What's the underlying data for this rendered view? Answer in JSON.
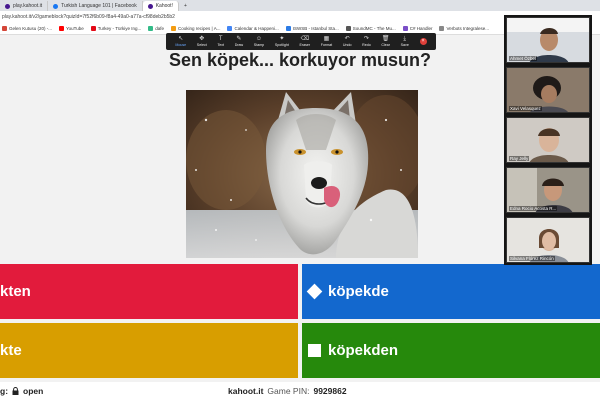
{
  "browser": {
    "tabs": [
      {
        "label": "play.kahoot.it",
        "color": "#46178f"
      },
      {
        "label": "Turkish Language 101 | Facebook",
        "color": "#1877f2"
      },
      {
        "label": "Kahoot!",
        "color": "#46178f"
      }
    ],
    "new_tab": "+",
    "url": "play.kahoot.it/v2/gameblock?quizId=7f52f6b09-f8a4-49a0-a77a-cf98deb2b5b2"
  },
  "bookmarks": [
    {
      "label": "Gelen Kutusu (20) -...",
      "color": "#d44638"
    },
    {
      "label": "YouTube",
      "color": "#ff0000"
    },
    {
      "label": "Turkey - Türkiye Ing...",
      "color": "#e30a17"
    },
    {
      "label": "dafe",
      "color": "#3b8"
    },
    {
      "label": "Cooking recipes | A...",
      "color": "#f39c12"
    },
    {
      "label": "Calendar & Happeni...",
      "color": "#4285f4"
    },
    {
      "label": "ISWSB - Istanbul Sta...",
      "color": "#2c7be5"
    },
    {
      "label": "SoundMC - The Mu...",
      "color": "#555555"
    },
    {
      "label": "C# Handler",
      "color": "#7b4fc7"
    },
    {
      "label": "Verbots Integralese...",
      "color": "#888888"
    }
  ],
  "zoom_toolbar": {
    "tools": [
      {
        "label": "Mouse",
        "icon": "↖"
      },
      {
        "label": "Select",
        "icon": "✥"
      },
      {
        "label": "Text",
        "icon": "T"
      },
      {
        "label": "Draw",
        "icon": "✎"
      },
      {
        "label": "Stamp",
        "icon": "☺"
      },
      {
        "label": "Spotlight",
        "icon": "✦"
      },
      {
        "label": "Eraser",
        "icon": "⌫"
      },
      {
        "label": "Format",
        "icon": "▦"
      },
      {
        "label": "Undo",
        "icon": "↶"
      },
      {
        "label": "Redo",
        "icon": "↷"
      },
      {
        "label": "Clear",
        "icon": "🗑"
      },
      {
        "label": "Save",
        "icon": "⤓"
      }
    ],
    "close": "×"
  },
  "question": {
    "title": "Sen köpek... korkuyor musun?"
  },
  "answers": [
    {
      "label": "kten",
      "color": "#e21b3c",
      "shape": "triangle"
    },
    {
      "label": "köpekde",
      "color": "#1368ce",
      "shape": "diamond"
    },
    {
      "label": "kte",
      "color": "#d89e00",
      "shape": "circle"
    },
    {
      "label": "köpekden",
      "color": "#26890c",
      "shape": "square"
    }
  ],
  "bottom_bar": {
    "lock_prefix": "g:",
    "lock_status": "open",
    "site": "kahoot.it",
    "pin_label": "Game PIN:",
    "pin": "9929862"
  },
  "participants": [
    {
      "name": "Ahmet Özbel"
    },
    {
      "name": "Xavi Velasquez"
    },
    {
      "name": "Ray Jelly"
    },
    {
      "name": "Edna Rocio Acosta R..."
    },
    {
      "name": "Silvana Flórez Rincón"
    }
  ]
}
